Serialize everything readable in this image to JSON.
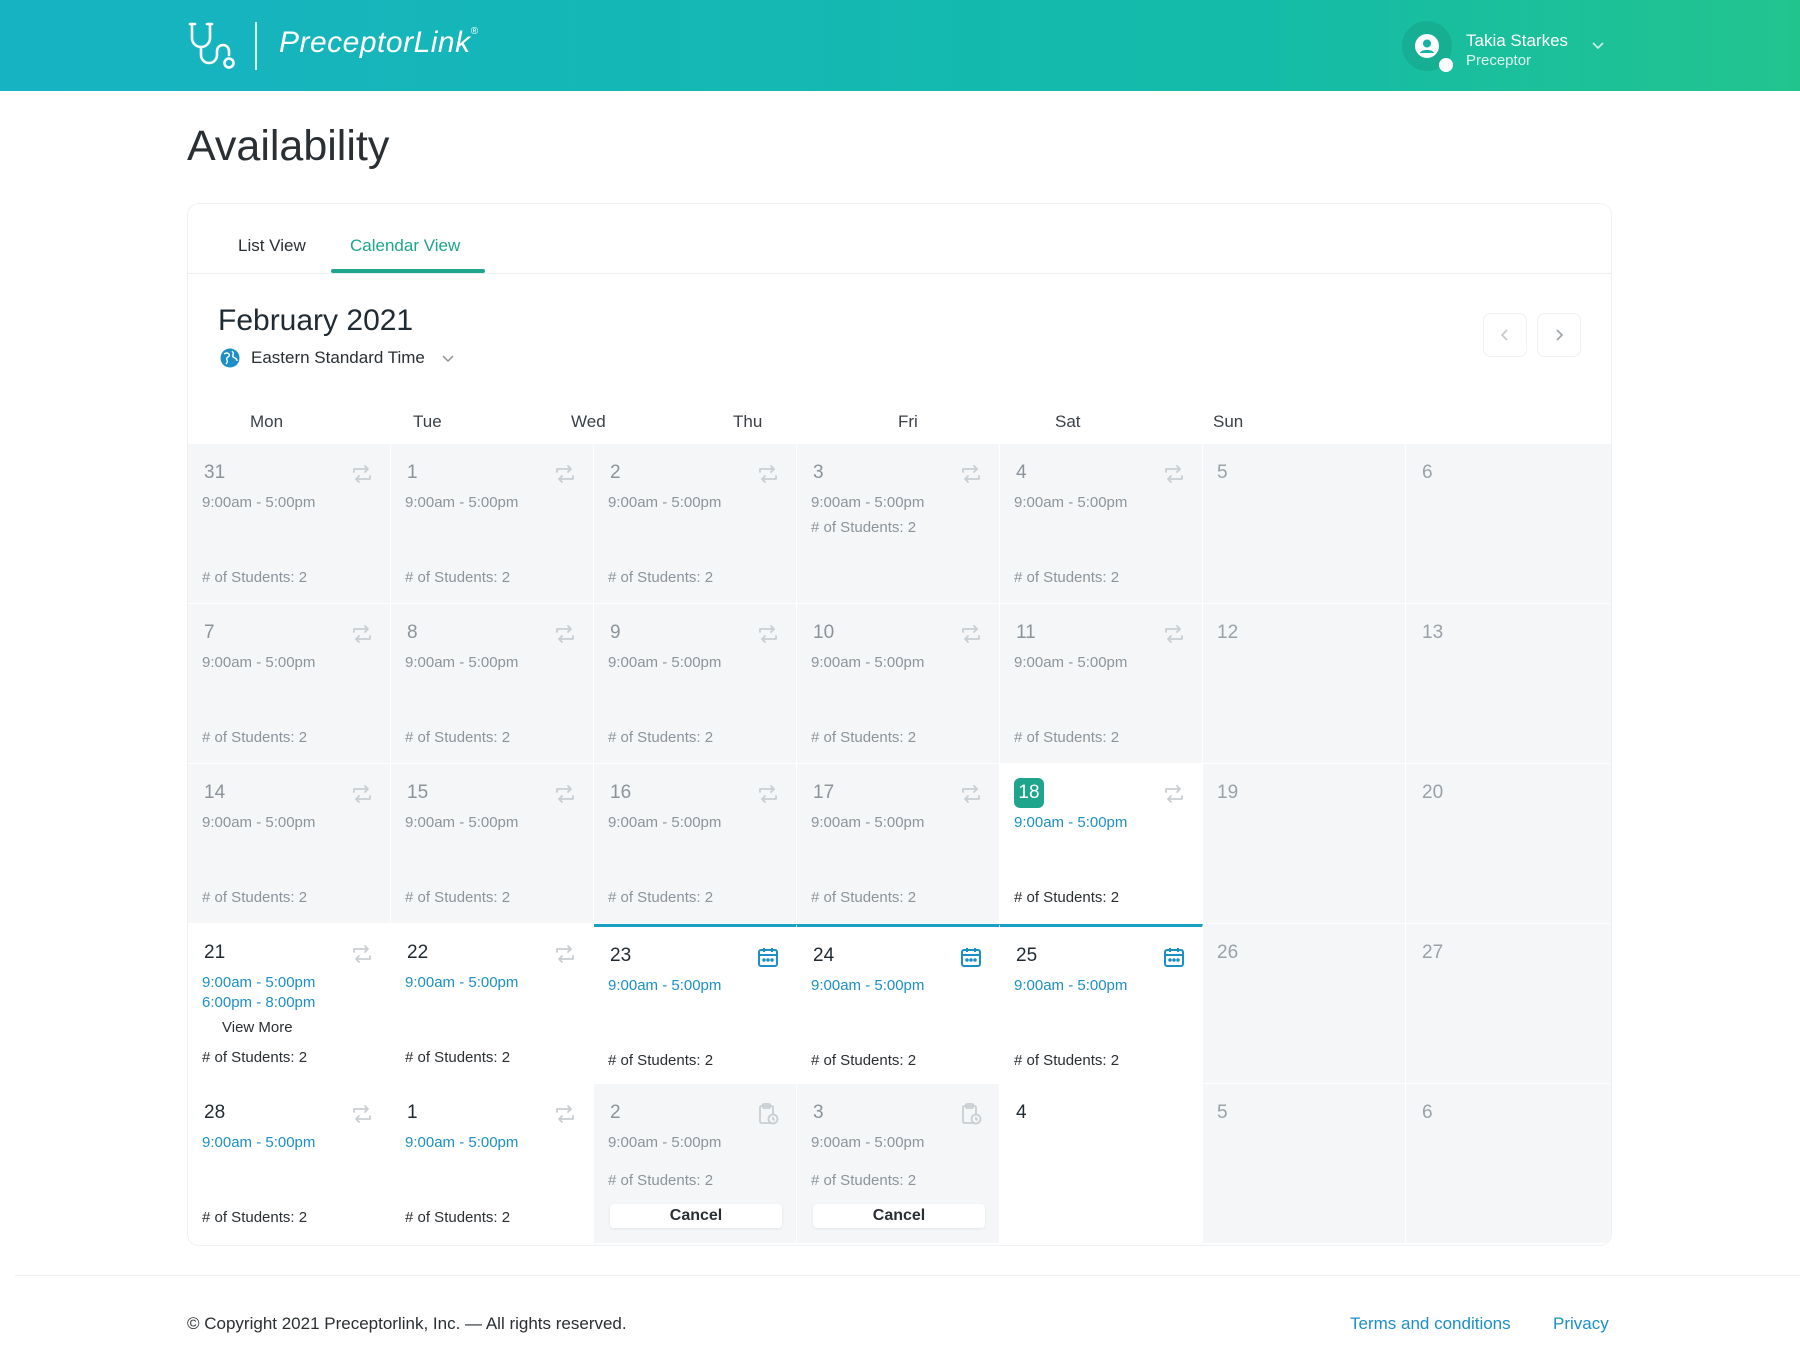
{
  "header": {
    "brand": "PreceptorLink",
    "brand_mark": "®",
    "user_name": "Takia Starkes",
    "user_role": "Preceptor"
  },
  "page": {
    "title": "Availability"
  },
  "tabs": {
    "list": "List View",
    "calendar": "Calendar View",
    "active": "calendar"
  },
  "calendar": {
    "month": "February 2021",
    "timezone": "Eastern Standard Time",
    "weekdays": [
      "Mon",
      "Tue",
      "Wed",
      "Thu",
      "Fri",
      "Sat",
      "Sun"
    ],
    "view_more": "View More",
    "cancel": "Cancel",
    "weeks": [
      [
        {
          "day": "31",
          "state": "past",
          "icon": "repeat-icon",
          "times": [
            "9:00am - 5:00pm"
          ],
          "students": "# of Students: 2"
        },
        {
          "day": "1",
          "state": "past",
          "icon": "repeat-icon",
          "times": [
            "9:00am - 5:00pm"
          ],
          "students": "# of Students: 2"
        },
        {
          "day": "2",
          "state": "past",
          "icon": "repeat-icon",
          "times": [
            "9:00am - 5:00pm"
          ],
          "students": "# of Students: 2"
        },
        {
          "day": "3",
          "state": "past",
          "icon": "repeat-icon",
          "times": [
            "9:00am - 5:00pm"
          ],
          "students": "# of Students: 2",
          "students_inline": true
        },
        {
          "day": "4",
          "state": "past",
          "icon": "repeat-icon",
          "times": [
            "9:00am - 5:00pm"
          ],
          "students": "# of Students: 2"
        },
        {
          "day": "5",
          "state": "weekend"
        },
        {
          "day": "6",
          "state": "weekend"
        }
      ],
      [
        {
          "day": "7",
          "state": "past",
          "icon": "repeat-icon",
          "times": [
            "9:00am - 5:00pm"
          ],
          "students": "# of Students: 2"
        },
        {
          "day": "8",
          "state": "past",
          "icon": "repeat-icon",
          "times": [
            "9:00am - 5:00pm"
          ],
          "students": "# of Students: 2"
        },
        {
          "day": "9",
          "state": "past",
          "icon": "repeat-icon",
          "times": [
            "9:00am - 5:00pm"
          ],
          "students": "# of Students: 2"
        },
        {
          "day": "10",
          "state": "past",
          "icon": "repeat-icon",
          "times": [
            "9:00am - 5:00pm"
          ],
          "students": "# of Students: 2"
        },
        {
          "day": "11",
          "state": "past",
          "icon": "repeat-icon",
          "times": [
            "9:00am - 5:00pm"
          ],
          "students": "# of Students: 2"
        },
        {
          "day": "12",
          "state": "weekend"
        },
        {
          "day": "13",
          "state": "weekend"
        }
      ],
      [
        {
          "day": "14",
          "state": "past",
          "icon": "repeat-icon",
          "times": [
            "9:00am - 5:00pm"
          ],
          "students": "# of Students: 2"
        },
        {
          "day": "15",
          "state": "past",
          "icon": "repeat-icon",
          "times": [
            "9:00am - 5:00pm"
          ],
          "students": "# of Students: 2"
        },
        {
          "day": "16",
          "state": "past",
          "icon": "repeat-icon",
          "times": [
            "9:00am - 5:00pm"
          ],
          "students": "# of Students: 2"
        },
        {
          "day": "17",
          "state": "past",
          "icon": "repeat-icon",
          "times": [
            "9:00am - 5:00pm"
          ],
          "students": "# of Students: 2"
        },
        {
          "day": "18",
          "state": "today",
          "icon": "repeat-icon",
          "times": [
            "9:00am - 5:00pm"
          ],
          "students": "# of Students: 2"
        },
        {
          "day": "19",
          "state": "weekend"
        },
        {
          "day": "20",
          "state": "weekend"
        }
      ],
      [
        {
          "day": "21",
          "state": "future",
          "icon": "repeat-icon",
          "times": [
            "9:00am - 5:00pm",
            "6:00pm - 8:00pm"
          ],
          "view_more": true,
          "students": "# of Students: 2"
        },
        {
          "day": "22",
          "state": "future",
          "icon": "repeat-icon",
          "times": [
            "9:00am - 5:00pm"
          ],
          "students": "# of Students: 2"
        },
        {
          "day": "23",
          "state": "week-sel",
          "icon": "calendar-icon",
          "times": [
            "9:00am - 5:00pm"
          ],
          "students": "# of Students: 2"
        },
        {
          "day": "24",
          "state": "week-sel",
          "icon": "calendar-icon",
          "times": [
            "9:00am - 5:00pm"
          ],
          "students": "# of Students: 2"
        },
        {
          "day": "25",
          "state": "week-sel",
          "icon": "calendar-icon",
          "times": [
            "9:00am - 5:00pm"
          ],
          "students": "# of Students: 2"
        },
        {
          "day": "26",
          "state": "weekend"
        },
        {
          "day": "27",
          "state": "weekend"
        }
      ],
      [
        {
          "day": "28",
          "state": "future",
          "icon": "repeat-icon",
          "times": [
            "9:00am - 5:00pm"
          ],
          "students": "# of Students: 2"
        },
        {
          "day": "1",
          "state": "future",
          "icon": "repeat-icon",
          "times": [
            "9:00am - 5:00pm"
          ],
          "students": "# of Students: 2"
        },
        {
          "day": "2",
          "state": "pending",
          "icon": "clipboard-clock-icon",
          "times": [
            "9:00am - 5:00pm"
          ],
          "students": "# of Students: 2",
          "cancel": true
        },
        {
          "day": "3",
          "state": "pending",
          "icon": "clipboard-clock-icon",
          "times": [
            "9:00am - 5:00pm"
          ],
          "students": "# of Students: 2",
          "cancel": true
        },
        {
          "day": "4",
          "state": "future"
        },
        {
          "day": "5",
          "state": "weekend"
        },
        {
          "day": "6",
          "state": "weekend"
        }
      ]
    ]
  },
  "footer": {
    "copyright": "© Copyright 2021 Preceptorlink, Inc. — All rights reserved.",
    "terms": "Terms and conditions",
    "privacy": "Privacy"
  },
  "colors": {
    "accent": "#1fa58c",
    "link": "#1c8fc6",
    "header_start": "#16b3c3",
    "header_end": "#22c48e"
  }
}
